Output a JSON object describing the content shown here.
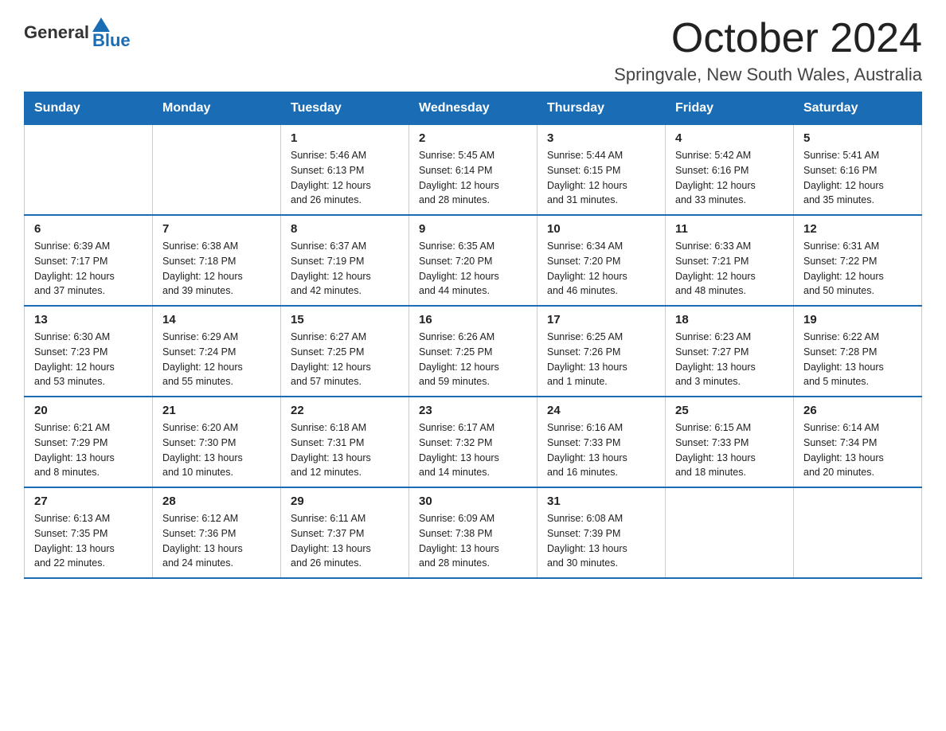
{
  "header": {
    "logo_general": "General",
    "logo_blue": "Blue",
    "title": "October 2024",
    "subtitle": "Springvale, New South Wales, Australia"
  },
  "days_of_week": [
    "Sunday",
    "Monday",
    "Tuesday",
    "Wednesday",
    "Thursday",
    "Friday",
    "Saturday"
  ],
  "weeks": [
    [
      {
        "day": "",
        "info": ""
      },
      {
        "day": "",
        "info": ""
      },
      {
        "day": "1",
        "info": "Sunrise: 5:46 AM\nSunset: 6:13 PM\nDaylight: 12 hours\nand 26 minutes."
      },
      {
        "day": "2",
        "info": "Sunrise: 5:45 AM\nSunset: 6:14 PM\nDaylight: 12 hours\nand 28 minutes."
      },
      {
        "day": "3",
        "info": "Sunrise: 5:44 AM\nSunset: 6:15 PM\nDaylight: 12 hours\nand 31 minutes."
      },
      {
        "day": "4",
        "info": "Sunrise: 5:42 AM\nSunset: 6:16 PM\nDaylight: 12 hours\nand 33 minutes."
      },
      {
        "day": "5",
        "info": "Sunrise: 5:41 AM\nSunset: 6:16 PM\nDaylight: 12 hours\nand 35 minutes."
      }
    ],
    [
      {
        "day": "6",
        "info": "Sunrise: 6:39 AM\nSunset: 7:17 PM\nDaylight: 12 hours\nand 37 minutes."
      },
      {
        "day": "7",
        "info": "Sunrise: 6:38 AM\nSunset: 7:18 PM\nDaylight: 12 hours\nand 39 minutes."
      },
      {
        "day": "8",
        "info": "Sunrise: 6:37 AM\nSunset: 7:19 PM\nDaylight: 12 hours\nand 42 minutes."
      },
      {
        "day": "9",
        "info": "Sunrise: 6:35 AM\nSunset: 7:20 PM\nDaylight: 12 hours\nand 44 minutes."
      },
      {
        "day": "10",
        "info": "Sunrise: 6:34 AM\nSunset: 7:20 PM\nDaylight: 12 hours\nand 46 minutes."
      },
      {
        "day": "11",
        "info": "Sunrise: 6:33 AM\nSunset: 7:21 PM\nDaylight: 12 hours\nand 48 minutes."
      },
      {
        "day": "12",
        "info": "Sunrise: 6:31 AM\nSunset: 7:22 PM\nDaylight: 12 hours\nand 50 minutes."
      }
    ],
    [
      {
        "day": "13",
        "info": "Sunrise: 6:30 AM\nSunset: 7:23 PM\nDaylight: 12 hours\nand 53 minutes."
      },
      {
        "day": "14",
        "info": "Sunrise: 6:29 AM\nSunset: 7:24 PM\nDaylight: 12 hours\nand 55 minutes."
      },
      {
        "day": "15",
        "info": "Sunrise: 6:27 AM\nSunset: 7:25 PM\nDaylight: 12 hours\nand 57 minutes."
      },
      {
        "day": "16",
        "info": "Sunrise: 6:26 AM\nSunset: 7:25 PM\nDaylight: 12 hours\nand 59 minutes."
      },
      {
        "day": "17",
        "info": "Sunrise: 6:25 AM\nSunset: 7:26 PM\nDaylight: 13 hours\nand 1 minute."
      },
      {
        "day": "18",
        "info": "Sunrise: 6:23 AM\nSunset: 7:27 PM\nDaylight: 13 hours\nand 3 minutes."
      },
      {
        "day": "19",
        "info": "Sunrise: 6:22 AM\nSunset: 7:28 PM\nDaylight: 13 hours\nand 5 minutes."
      }
    ],
    [
      {
        "day": "20",
        "info": "Sunrise: 6:21 AM\nSunset: 7:29 PM\nDaylight: 13 hours\nand 8 minutes."
      },
      {
        "day": "21",
        "info": "Sunrise: 6:20 AM\nSunset: 7:30 PM\nDaylight: 13 hours\nand 10 minutes."
      },
      {
        "day": "22",
        "info": "Sunrise: 6:18 AM\nSunset: 7:31 PM\nDaylight: 13 hours\nand 12 minutes."
      },
      {
        "day": "23",
        "info": "Sunrise: 6:17 AM\nSunset: 7:32 PM\nDaylight: 13 hours\nand 14 minutes."
      },
      {
        "day": "24",
        "info": "Sunrise: 6:16 AM\nSunset: 7:33 PM\nDaylight: 13 hours\nand 16 minutes."
      },
      {
        "day": "25",
        "info": "Sunrise: 6:15 AM\nSunset: 7:33 PM\nDaylight: 13 hours\nand 18 minutes."
      },
      {
        "day": "26",
        "info": "Sunrise: 6:14 AM\nSunset: 7:34 PM\nDaylight: 13 hours\nand 20 minutes."
      }
    ],
    [
      {
        "day": "27",
        "info": "Sunrise: 6:13 AM\nSunset: 7:35 PM\nDaylight: 13 hours\nand 22 minutes."
      },
      {
        "day": "28",
        "info": "Sunrise: 6:12 AM\nSunset: 7:36 PM\nDaylight: 13 hours\nand 24 minutes."
      },
      {
        "day": "29",
        "info": "Sunrise: 6:11 AM\nSunset: 7:37 PM\nDaylight: 13 hours\nand 26 minutes."
      },
      {
        "day": "30",
        "info": "Sunrise: 6:09 AM\nSunset: 7:38 PM\nDaylight: 13 hours\nand 28 minutes."
      },
      {
        "day": "31",
        "info": "Sunrise: 6:08 AM\nSunset: 7:39 PM\nDaylight: 13 hours\nand 30 minutes."
      },
      {
        "day": "",
        "info": ""
      },
      {
        "day": "",
        "info": ""
      }
    ]
  ]
}
